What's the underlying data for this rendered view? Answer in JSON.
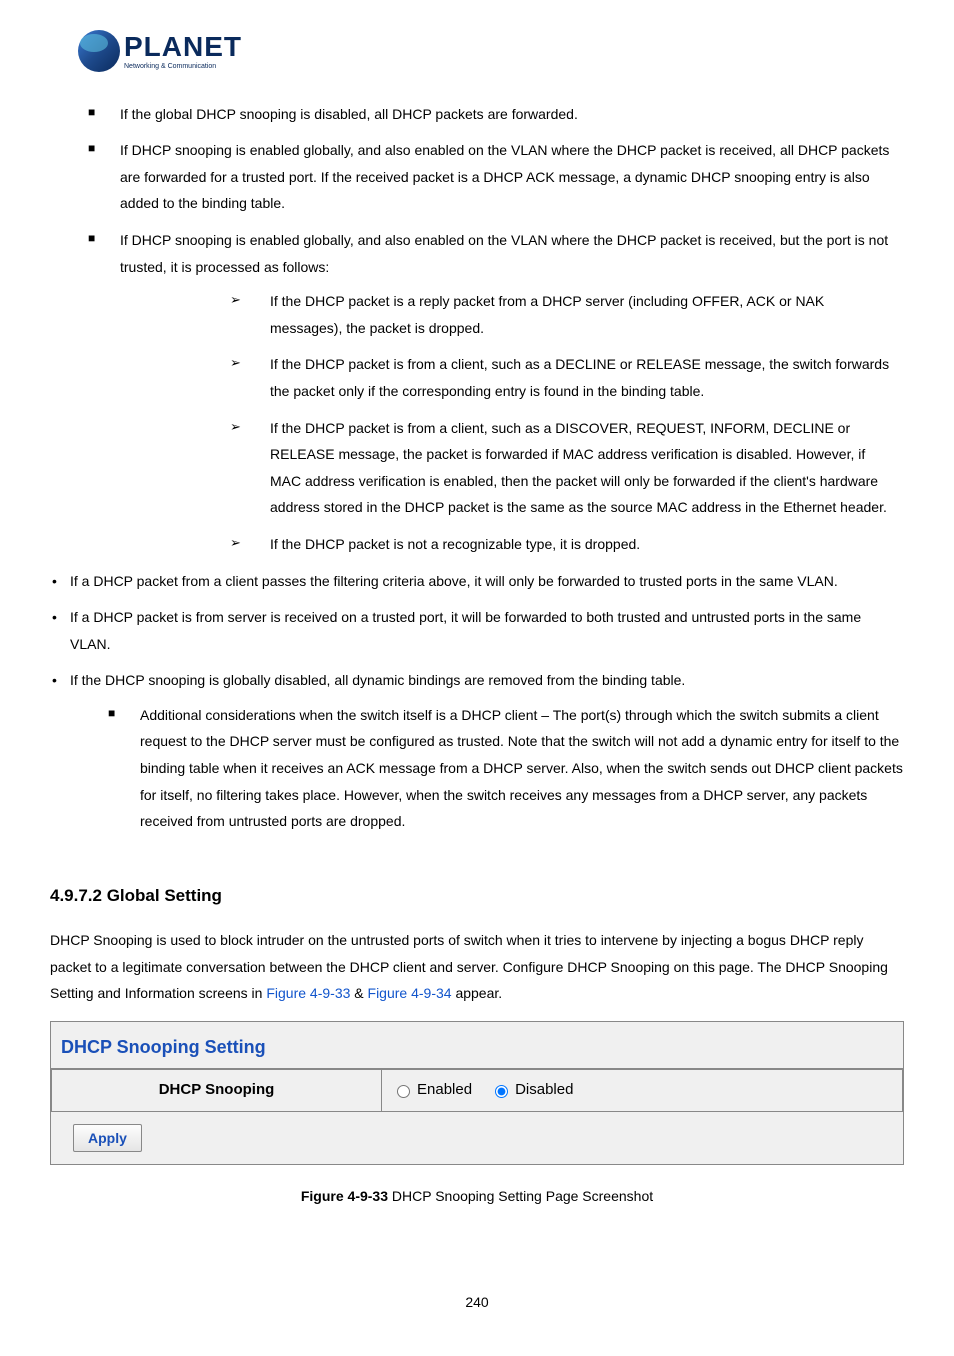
{
  "logo": {
    "name": "PLANET",
    "tagline": "Networking & Communication"
  },
  "bullets_level1": [
    "If the global DHCP snooping is disabled, all DHCP packets are forwarded.",
    "If DHCP snooping is enabled globally, and also enabled on the VLAN where the DHCP packet is received, all DHCP packets are forwarded for a trusted port. If the received packet is a DHCP ACK message, a dynamic DHCP snooping entry is also added to the binding table.",
    "If DHCP snooping is enabled globally, and also enabled on the VLAN where the DHCP packet is received, but the port is not trusted, it is processed as follows:"
  ],
  "bullets_level2": [
    "If the DHCP packet is a reply packet from a DHCP server (including OFFER, ACK or NAK messages), the packet is dropped.",
    "If the DHCP packet is from a client, such as a DECLINE or RELEASE message, the switch forwards the packet only if the corresponding entry is found in the binding table.",
    "If the DHCP packet is from a client, such as a DISCOVER, REQUEST, INFORM, DECLINE or RELEASE message, the packet is forwarded if MAC address verification is disabled. However, if MAC address verification is enabled, then the packet will only be forwarded if the client's hardware address stored in the DHCP packet is the same as the source MAC address in the Ethernet header.",
    "If the DHCP packet is not a recognizable type, it is dropped."
  ],
  "bullets_level3": [
    "If a DHCP packet from a client passes the filtering criteria above, it will only be forwarded to trusted ports in the same VLAN.",
    "If a DHCP packet is from server is received on a trusted port, it will be forwarded to both trusted and untrusted ports in the same VLAN.",
    "If the DHCP snooping is globally disabled, all dynamic bindings are removed from the binding table."
  ],
  "bullets_level4": [
    "Additional considerations when the switch itself is a DHCP client – The port(s) through which the switch submits a client request to the DHCP server must be configured as trusted. Note that the switch will not add a dynamic entry for itself to the binding table when it receives an ACK message from a DHCP server. Also, when the switch sends out DHCP client packets for itself, no filtering takes place. However, when the switch receives any messages from a DHCP server, any packets received from untrusted ports are dropped."
  ],
  "section": {
    "heading": "4.9.7.2 Global Setting",
    "para1": "DHCP Snooping is used to block intruder on the untrusted ports of switch when it tries to intervene by injecting a bogus DHCP reply packet to a legitimate conversation between the DHCP client and server. Configure DHCP Snooping on this page. The DHCP Snooping Setting and Information screens in ",
    "link1": "Figure 4-9-33",
    "amp": " & ",
    "link2": "Figure 4-9-34",
    "para1_tail": " appear."
  },
  "setting": {
    "title": "DHCP Snooping Setting",
    "row_label": "DHCP Snooping",
    "opt_enabled": "Enabled",
    "opt_disabled": "Disabled",
    "apply": "Apply"
  },
  "caption": {
    "bold": "Figure 4-9-33",
    "rest": " DHCP Snooping Setting Page Screenshot"
  },
  "pagenum": "240"
}
